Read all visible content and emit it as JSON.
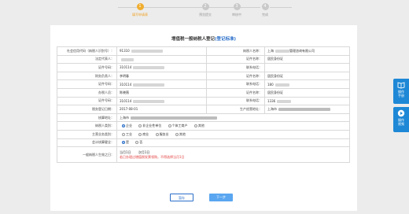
{
  "steps": [
    {
      "num": "1",
      "label": "填写申请表",
      "active": true
    },
    {
      "num": "2",
      "label": "预览提交",
      "active": false
    },
    {
      "num": "3",
      "label": "审核中",
      "active": false
    },
    {
      "num": "4",
      "label": "完成",
      "active": false
    }
  ],
  "form": {
    "title": "增值税一般纳税人登记",
    "title_link": "(登记标准)",
    "rows": {
      "r1": {
        "l1": "社会信用代码（纳税人识别号）：",
        "v1": "91310",
        "l2": "纳税人名称：",
        "v2a": "上海",
        "v2b": "管理咨询有限公司"
      },
      "r2": {
        "l1": "法定代表人：",
        "l2": "证件名称：",
        "v2": "居民身份证"
      },
      "r3": {
        "l1": "证件号码：",
        "v1": "310114",
        "l2": "联系电话："
      },
      "r4": {
        "l1": "财务负责人：",
        "v1": "李明春",
        "l2": "证件名称：",
        "v2": "居民身份证"
      },
      "r5": {
        "l1": "证件号码：",
        "v1": "310114",
        "l2": "联系电话：",
        "v2": "180"
      },
      "r6": {
        "l1": "办税人员：",
        "v1": "陈晓薇",
        "l2": "证件名称：",
        "v2": "居民身份证"
      },
      "r7": {
        "l1": "证件号码：",
        "v1": "310114",
        "l2": "联系电话：",
        "v2": "1336"
      },
      "r8": {
        "l1": "税务登记日期：",
        "v1": "2017-08-01",
        "l2": "生产经营地址：",
        "v2": "上海市"
      },
      "r9": {
        "l1": "核算地址：",
        "v1": "上海市"
      },
      "r10": {
        "l1": "纳税人类别：",
        "opts": [
          "企业",
          "非企业性单位",
          "个体工商户",
          "其他"
        ],
        "selected": 0
      },
      "r11": {
        "l1": "主营业务类别：",
        "opts": [
          "工业",
          "商业",
          "服务业",
          "其他"
        ],
        "selected": -1
      },
      "r12": {
        "l1": "会计核算健全：",
        "opts": [
          "是",
          "否"
        ],
        "selected": 0
      },
      "r13": {
        "l1": "一般纳税人生效之日：",
        "d1": "当月1日",
        "d2": "次月1日",
        "warn": "若已办理过增值税发票领购，不得选择当月1日"
      }
    }
  },
  "buttons": {
    "save": "暂存",
    "next": "下一步"
  },
  "side": [
    {
      "label1": "操作",
      "label2": "手册"
    },
    {
      "label1": "操作",
      "label2": "视频"
    }
  ]
}
